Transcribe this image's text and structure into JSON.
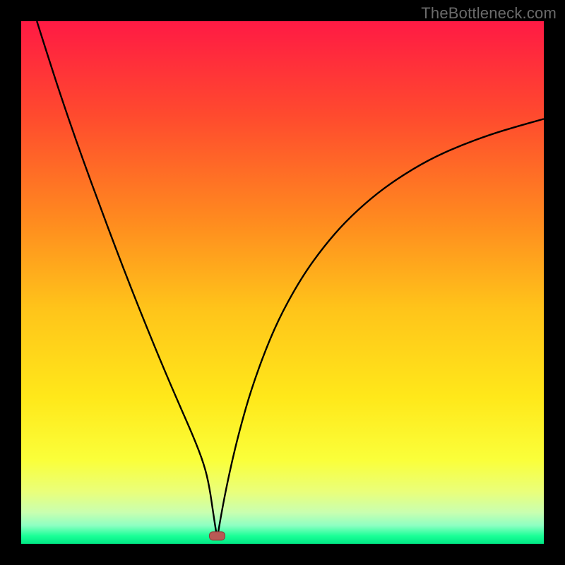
{
  "watermark": "TheBottleneck.com",
  "colors": {
    "frame": "#000000",
    "curve": "#000000",
    "marker_fill": "#b95a55",
    "marker_stroke": "#8c3a36",
    "gradient_stops": [
      {
        "offset": 0.0,
        "color": "#ff1a44"
      },
      {
        "offset": 0.18,
        "color": "#ff4a2e"
      },
      {
        "offset": 0.38,
        "color": "#ff8a1f"
      },
      {
        "offset": 0.55,
        "color": "#ffc41a"
      },
      {
        "offset": 0.72,
        "color": "#ffe81a"
      },
      {
        "offset": 0.84,
        "color": "#faff3a"
      },
      {
        "offset": 0.9,
        "color": "#eaff7a"
      },
      {
        "offset": 0.94,
        "color": "#c9ffb0"
      },
      {
        "offset": 0.965,
        "color": "#8dffc2"
      },
      {
        "offset": 0.985,
        "color": "#1aff97"
      },
      {
        "offset": 1.0,
        "color": "#00e884"
      }
    ]
  },
  "chart_data": {
    "type": "line",
    "title": "",
    "xlabel": "",
    "ylabel": "",
    "xlim": [
      0,
      100
    ],
    "ylim": [
      0,
      100
    ],
    "marker": {
      "x": 37.5,
      "y": 1.5
    },
    "series": [
      {
        "name": "left",
        "x": [
          3.0,
          6,
          9,
          12,
          15,
          18,
          21,
          24,
          27,
          30,
          33,
          35,
          36,
          36.8,
          37.5
        ],
        "values": [
          100,
          90.5,
          81.5,
          73,
          64.8,
          56.8,
          49,
          41.5,
          34.2,
          27.2,
          20.4,
          15.2,
          11.0,
          5.5,
          1.0
        ]
      },
      {
        "name": "right",
        "x": [
          37.5,
          38.2,
          39.2,
          40.5,
          42,
          44,
          47,
          50,
          54,
          58,
          62,
          67,
          72,
          78,
          84,
          90,
          95,
          100
        ],
        "values": [
          1.0,
          5.2,
          10.5,
          16.5,
          22.5,
          29.5,
          37.8,
          44.5,
          51.5,
          57.0,
          61.6,
          66.2,
          69.9,
          73.5,
          76.2,
          78.4,
          79.9,
          81.3
        ]
      }
    ]
  }
}
